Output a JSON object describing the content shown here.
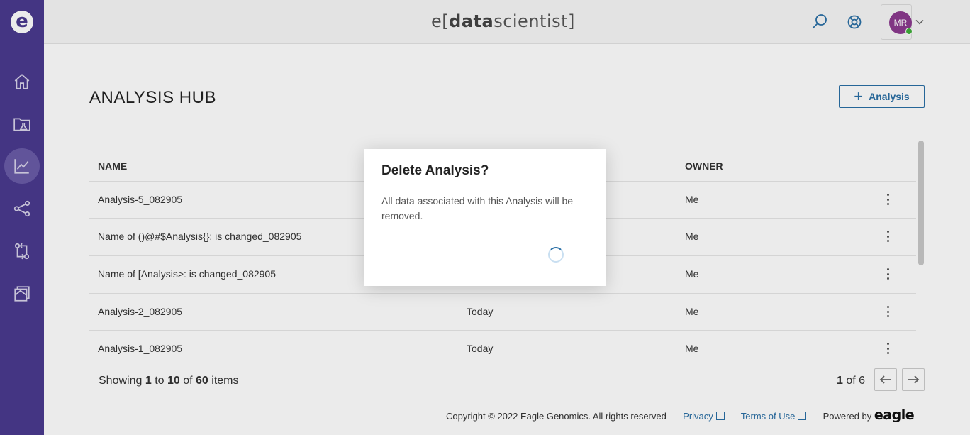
{
  "app": {
    "brand_prefix": "e",
    "brand_open": "[",
    "brand_bold": "data",
    "brand_rest": "scientist",
    "brand_close": "]"
  },
  "sidebar": {
    "logo_letter": "e",
    "items": [
      {
        "icon": "home-icon",
        "active": false
      },
      {
        "icon": "folder-lab-icon",
        "active": false
      },
      {
        "icon": "chart-line-icon",
        "active": true
      },
      {
        "icon": "share-nodes-icon",
        "active": false
      },
      {
        "icon": "transfer-icon",
        "active": false
      },
      {
        "icon": "archive-icon",
        "active": false
      }
    ]
  },
  "header": {
    "search_icon": "search-icon",
    "help_icon": "help-lifebuoy-icon",
    "user_initials": "MR",
    "avatar_color": "#8b3a8f",
    "status_color": "#3fae3a"
  },
  "page": {
    "title": "ANALYSIS HUB",
    "add_button_label": "Analysis"
  },
  "table": {
    "headers": {
      "name": "NAME",
      "owner": "OWNER"
    },
    "rows": [
      {
        "name": "Analysis-5_082905",
        "date": "",
        "owner": "Me"
      },
      {
        "name": "Name of ()@#$Analysis{}: is changed_082905",
        "date": "",
        "owner": "Me"
      },
      {
        "name": "Name of [Analysis>: is changed_082905",
        "date": "",
        "owner": "Me"
      },
      {
        "name": "Analysis-2_082905",
        "date": "Today",
        "owner": "Me"
      },
      {
        "name": "Analysis-1_082905",
        "date": "Today",
        "owner": "Me"
      }
    ]
  },
  "pagination": {
    "showing_prefix": "Showing",
    "from": "1",
    "to_word": "to",
    "to": "10",
    "of_word": "of",
    "total": "60",
    "items_word": "items",
    "page": "1",
    "page_of": "of 6"
  },
  "footer": {
    "copyright": "Copyright © 2022 Eagle Genomics. All rights reserved",
    "privacy": "Privacy",
    "terms": "Terms of Use",
    "powered_by": "Powered by",
    "powered_logo": "eagle"
  },
  "modal": {
    "title": "Delete Analysis?",
    "body": "All data associated with this Analysis will be removed.",
    "loading": true
  },
  "colors": {
    "sidebar": "#4a3a8f",
    "accent": "#2a6fa5"
  }
}
